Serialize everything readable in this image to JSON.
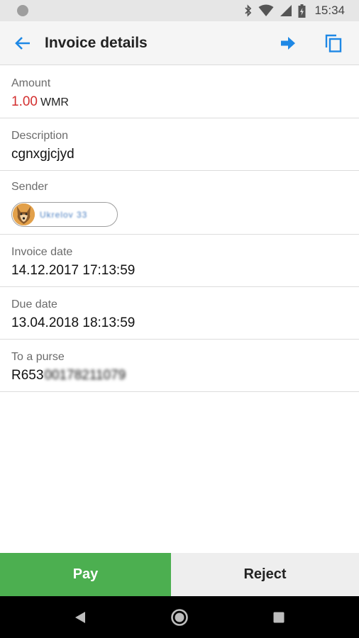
{
  "status_bar": {
    "time": "15:34",
    "icons": [
      "bluetooth-icon",
      "wifi-icon",
      "cell-signal-icon",
      "battery-icon"
    ]
  },
  "app_bar": {
    "title": "Invoice details",
    "back_icon": "arrow-back-icon",
    "forward_icon": "arrow-forward-icon",
    "copy_icon": "copy-icon"
  },
  "fields": {
    "amount": {
      "label": "Amount",
      "value": "1.00",
      "currency": "WMR"
    },
    "description": {
      "label": "Description",
      "value": "cgnxgjcjyd"
    },
    "sender": {
      "label": "Sender",
      "name": "Ukrelov 33"
    },
    "invoice_date": {
      "label": "Invoice date",
      "value": "14.12.2017 17:13:59"
    },
    "due_date": {
      "label": "Due date",
      "value": "13.04.2018 18:13:59"
    },
    "purse": {
      "label": "To a purse",
      "prefix": "R653",
      "rest": "00178211079"
    }
  },
  "actions": {
    "pay_label": "Pay",
    "reject_label": "Reject"
  },
  "nav": [
    "back-triangle-icon",
    "home-circle-icon",
    "recents-square-icon"
  ],
  "colors": {
    "accent": "#1e88e5",
    "amount": "#d32f2f",
    "pay": "#4caf50",
    "reject": "#eeeeee"
  }
}
